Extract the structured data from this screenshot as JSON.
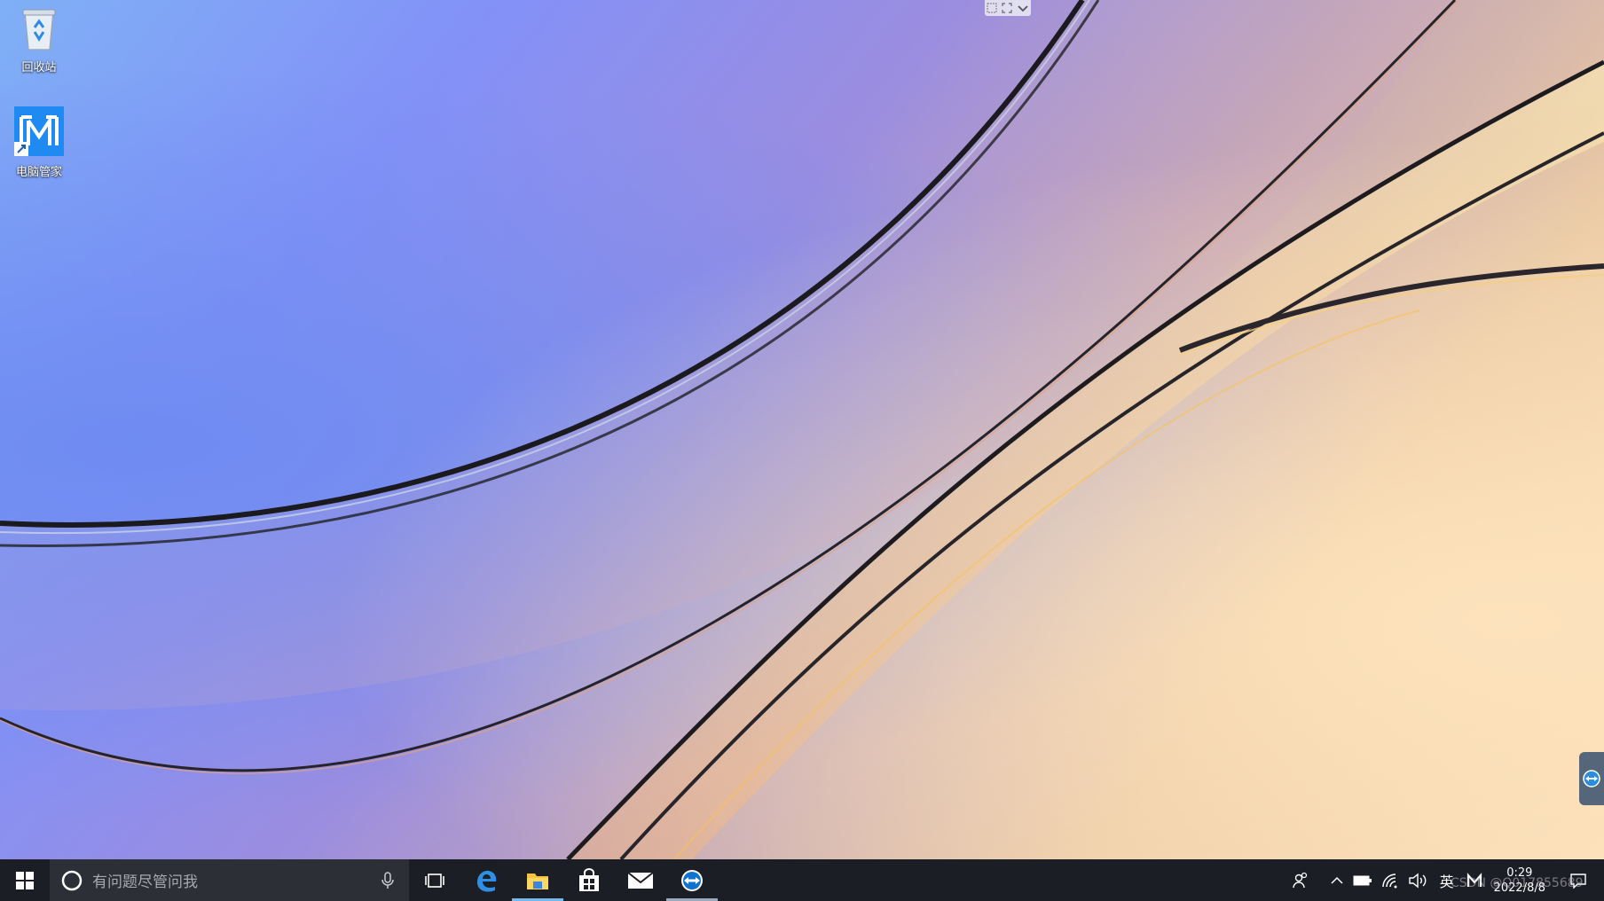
{
  "desktop": {
    "icons": [
      {
        "label": "回收站",
        "icon": "recycle-bin-icon"
      },
      {
        "label": "电脑管家",
        "icon": "pc-manager-icon"
      }
    ]
  },
  "taskbar": {
    "search_placeholder": "有问题尽管问我",
    "pinned": [
      "task-view-icon",
      "edge-icon",
      "file-explorer-icon",
      "store-icon",
      "mail-icon",
      "teamviewer-icon"
    ],
    "tray": {
      "ime": "英",
      "time": "0:29",
      "date": "2022/8/8"
    }
  },
  "watermark": "CSDN @Q017855689",
  "colors": {
    "taskbar": "#1c1e25",
    "search": "#2d2f36",
    "accent": "#76b9ed"
  }
}
